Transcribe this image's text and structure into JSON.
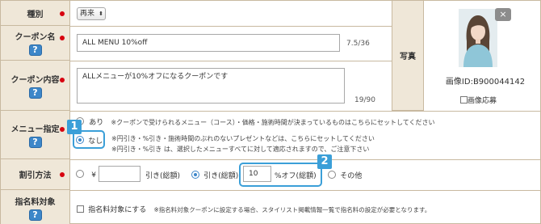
{
  "labels": {
    "type": "種別",
    "coupon_name": "クーポン名",
    "coupon_content": "クーポン内容",
    "menu_spec": "メニュー指定",
    "discount_method": "割引方法",
    "nomination_fee": "指名料対象",
    "photo": "写真"
  },
  "help_icon_text": "?",
  "type_select": {
    "value": "再来"
  },
  "coupon_name": {
    "value": "ALL MENU 10%off",
    "counter": "7.5/36"
  },
  "coupon_content": {
    "value": "ALLメニューが10%オフになるクーポンです",
    "counter": "19/90"
  },
  "photo": {
    "image_id": "画像ID:B900044142",
    "apply_label": "画像応募",
    "close_label": "×"
  },
  "menu_spec": {
    "option_yes": "あり",
    "option_yes_note": "※クーポンで受けられるメニュー（コース）・価格・施術時間が決まっているものはこちらにセットしてください",
    "option_no": "なし",
    "option_no_note1": "※円引き・%引き・施術時間のぶれのないプレゼントなどは、こちらにセットしてください",
    "option_no_note2": "※円引き・%引き は、選択したメニューすべてに対して適応されますので、ご注意下さい",
    "selected": "なし"
  },
  "discount": {
    "yen_symbol": "¥",
    "yen_value": "",
    "yen_suffix": "引き(総額)",
    "percent_prefix": "引き(総額)",
    "percent_value": "10",
    "percent_suffix": "%オフ(総額)",
    "other_label": "その他",
    "selected": "percent"
  },
  "nomination": {
    "checkbox_label": "指名料対象にする",
    "note": "※指名料対象クーポンに設定する場合、スタイリスト掲載情報一覧で指名料の設定が必要となります。",
    "checked": false
  },
  "callouts": {
    "badge1": "1",
    "badge2": "2"
  },
  "colors": {
    "label_bg": "#efe7d8",
    "border": "#c8b9a0",
    "required": "#d7000f",
    "accent": "#3b9fd8"
  }
}
